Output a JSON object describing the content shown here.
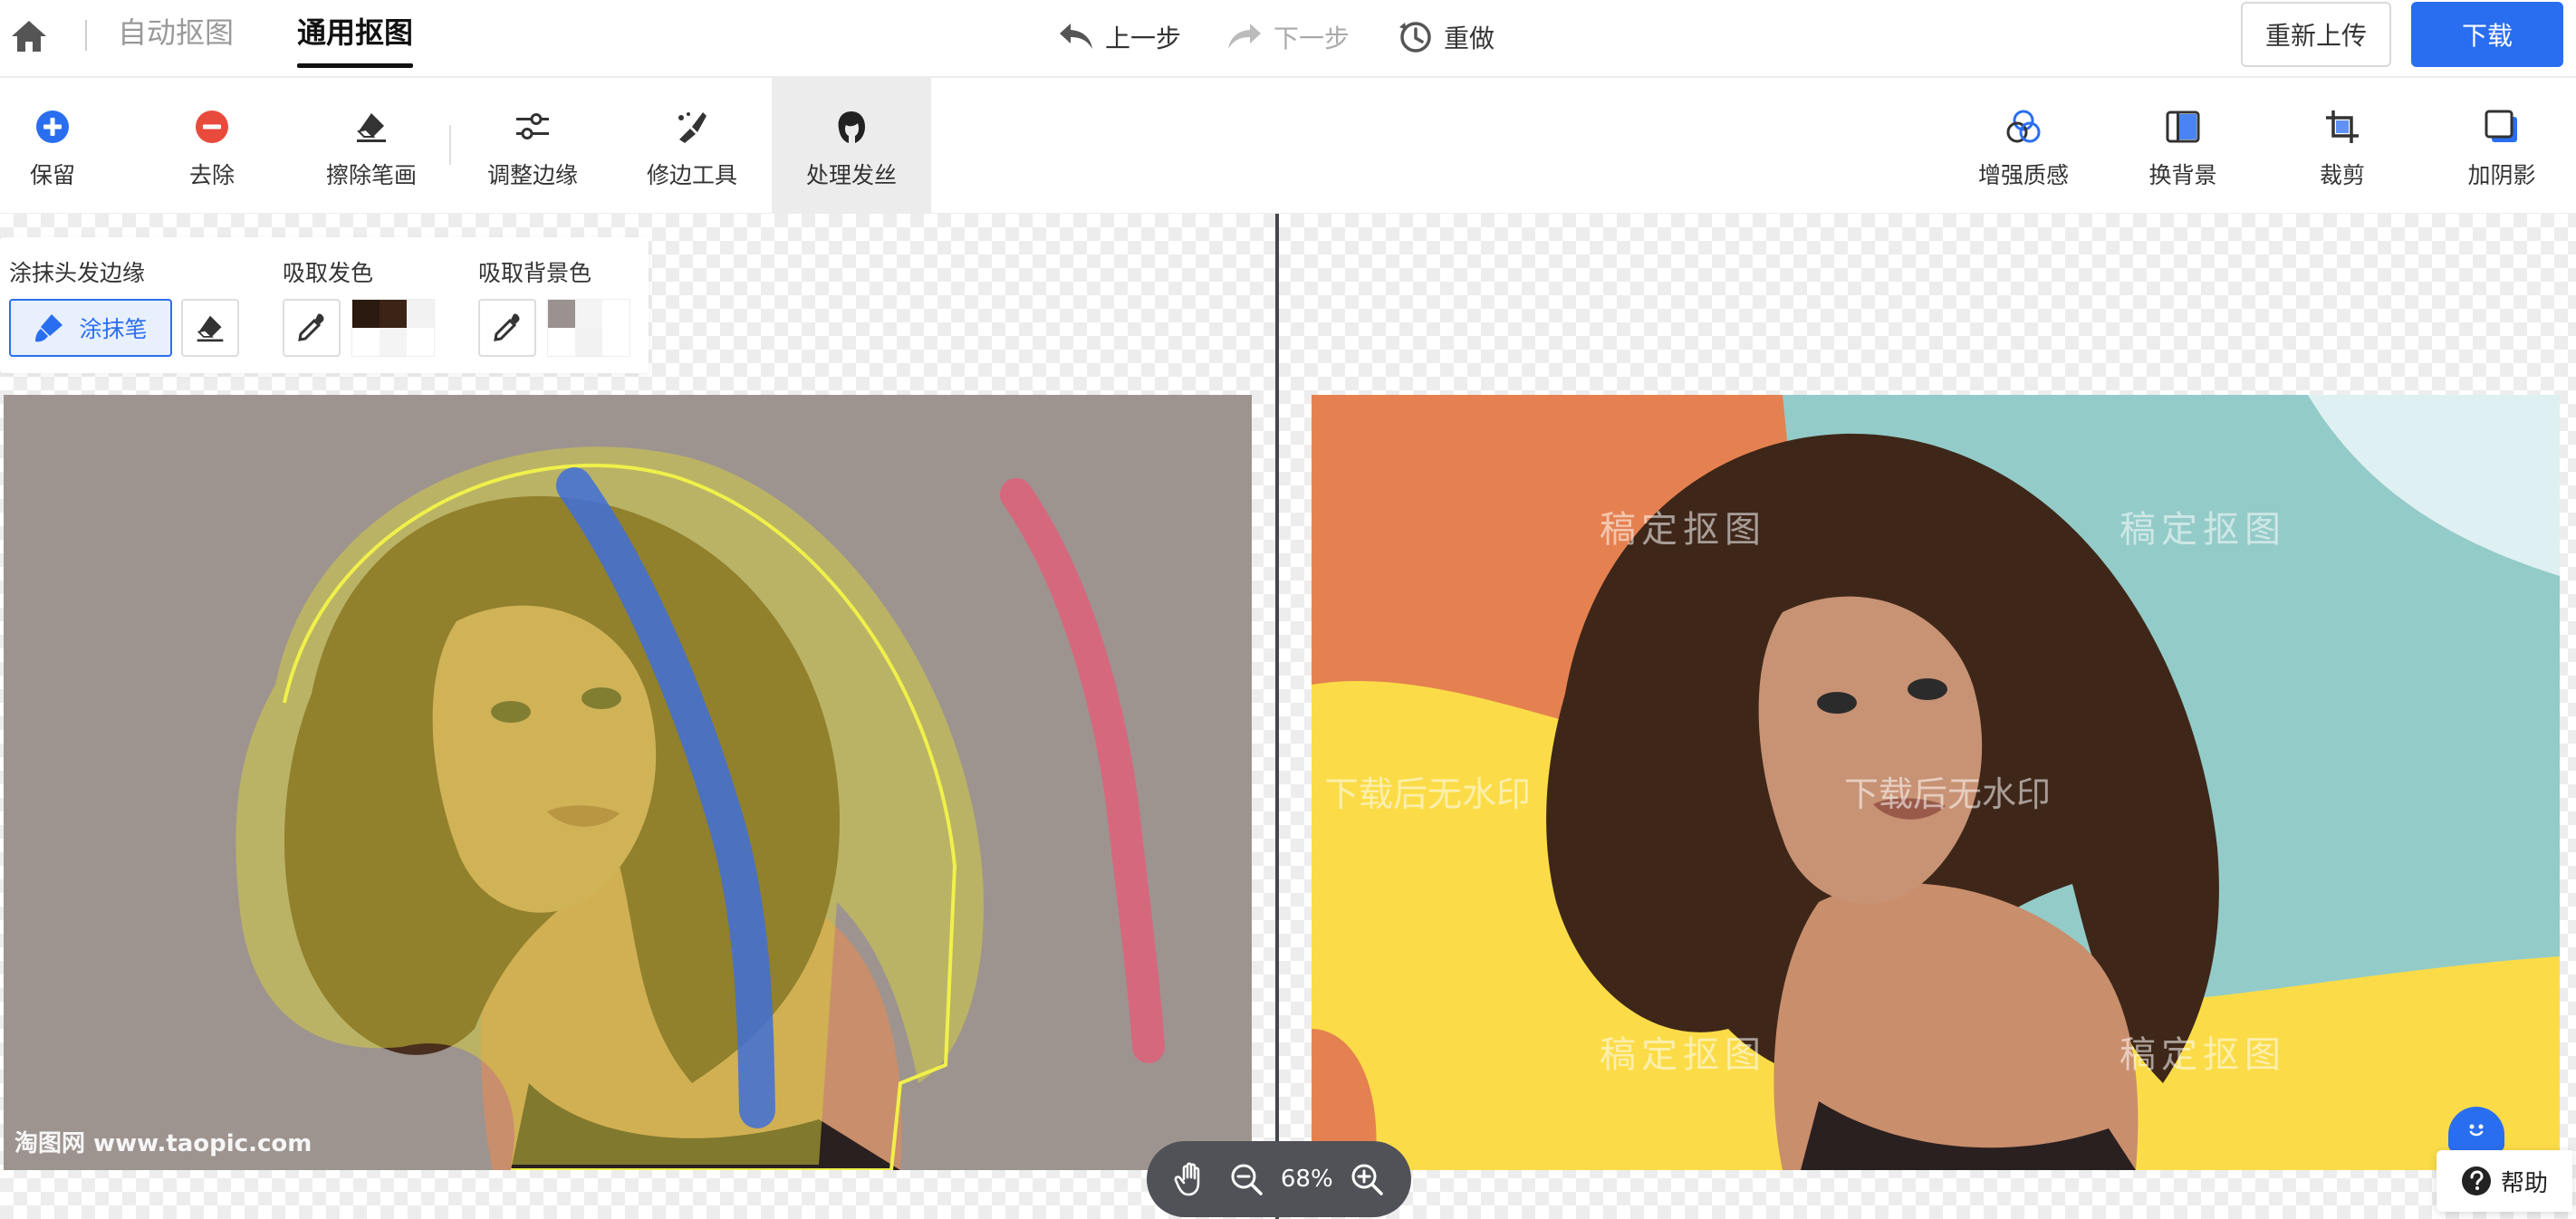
{
  "header": {
    "modes": [
      "自动抠图",
      "通用抠图"
    ],
    "history": {
      "undo": "上一步",
      "redo": "下一步",
      "reset": "重做"
    },
    "reupload_label": "重新上传",
    "download_label": "下载"
  },
  "toolbar": {
    "left_tools": [
      {
        "label": "保留",
        "icon": "plus-circle-icon"
      },
      {
        "label": "去除",
        "icon": "minus-circle-icon"
      },
      {
        "label": "擦除笔画",
        "icon": "eraser-icon"
      },
      {
        "label": "调整边缘",
        "icon": "sliders-icon"
      },
      {
        "label": "修边工具",
        "icon": "edge-brush-icon"
      },
      {
        "label": "处理发丝",
        "icon": "hair-head-icon"
      }
    ],
    "active_tool": "处理发丝",
    "right_tools": [
      {
        "label": "增强质感",
        "icon": "enhance-icon"
      },
      {
        "label": "换背景",
        "icon": "background-icon"
      },
      {
        "label": "裁剪",
        "icon": "crop-icon"
      },
      {
        "label": "加阴影",
        "icon": "shadow-icon"
      }
    ]
  },
  "hair_panel": {
    "smear_title": "涂抹头发边缘",
    "brush_label": "涂抹笔",
    "pick_hair_title": "吸取发色",
    "pick_bg_title": "吸取背景色",
    "hair_colors": [
      "#2a1a10",
      "#3b2416",
      "#f2f2f2",
      "#ffffff",
      "#f4f4f4",
      "#ffffff"
    ],
    "bg_colors": [
      "#9a9290",
      "#f4f4f4",
      "#ffffff",
      "#ffffff",
      "#f2f2f2",
      "#ffffff"
    ]
  },
  "canvas": {
    "source_watermark": "淘图网 www.taopic.com",
    "preview_watermarks": [
      "稿定抠图",
      "下载后无水印"
    ],
    "zoom": "68%",
    "help_label": "帮助"
  },
  "colors": {
    "accent": "#2a6ef0",
    "keep_stroke": "#3f6ed8",
    "remove_stroke": "#e0607a",
    "hair_mask": "#d8d23a"
  }
}
